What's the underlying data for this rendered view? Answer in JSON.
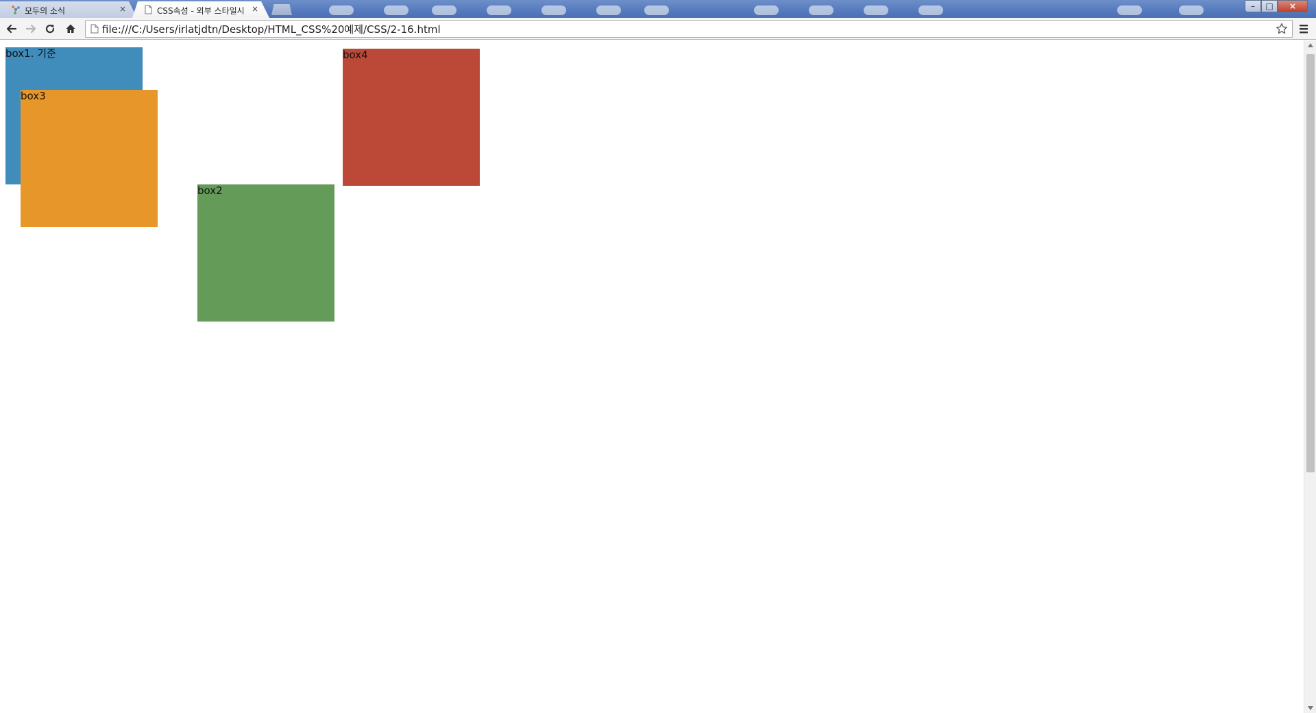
{
  "browser": {
    "tabs": [
      {
        "title": "모두의 소식",
        "icon": "share-network-icon",
        "active": false
      },
      {
        "title": "CSS속성 - 외부 스타일시",
        "icon": "page-icon",
        "active": true
      }
    ],
    "close_glyph": "×",
    "window_controls": {
      "minimize": "–",
      "maximize": "□",
      "close": "×"
    },
    "toolbar": {
      "url": "file:///C:/Users/irlatjdtn/Desktop/HTML_CSS%20예제/CSS/2-16.html"
    }
  },
  "page": {
    "boxes": [
      {
        "id": "box1",
        "label": "box1. 기준",
        "color": "#408cbb"
      },
      {
        "id": "box2",
        "label": "box2",
        "color": "#649b59"
      },
      {
        "id": "box3",
        "label": "box3",
        "color": "#e79629"
      },
      {
        "id": "box4",
        "label": "box4",
        "color": "#bc4938"
      }
    ]
  }
}
